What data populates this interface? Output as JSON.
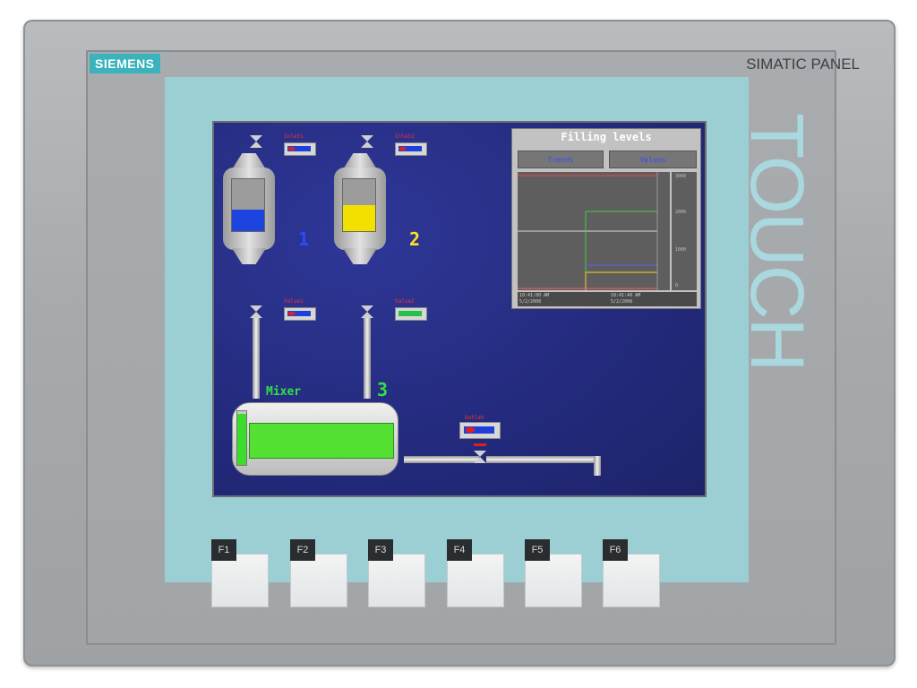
{
  "device": {
    "brand": "SIEMENS",
    "model": "SIMATIC PANEL",
    "touch_label": "TOUCH"
  },
  "tanks": [
    {
      "inlet_label": "Inlet1",
      "valve_label": "Valve1",
      "number": "1",
      "number_color": "#2b49ff",
      "fill_color": "#1e44e0",
      "fill_level": 0.42,
      "valve_state": "closed"
    },
    {
      "inlet_label": "Inlet2",
      "valve_label": "Valve2",
      "number": "2",
      "number_color": "#ffe020",
      "fill_color": "#f2e000",
      "fill_level": 0.5,
      "valve_state": "open"
    }
  ],
  "mixer": {
    "label": "Mixer",
    "number": "3",
    "number_color": "#33e045",
    "fill_color": "#55e034",
    "level": 0.95
  },
  "outlet": {
    "label": "Outlet"
  },
  "trend_view": {
    "title": "Filling levels",
    "buttons": [
      "Trends",
      "Values"
    ],
    "y_ticks": [
      "3000",
      "2000",
      "1000",
      "0"
    ],
    "footer": {
      "left_time": "10:41:00 AM",
      "left_date": "5/2/2008",
      "right_time": "10:41:40 AM",
      "right_date": "5/2/2008"
    }
  },
  "function_keys": [
    "F1",
    "F2",
    "F3",
    "F4",
    "F5",
    "F6"
  ]
}
